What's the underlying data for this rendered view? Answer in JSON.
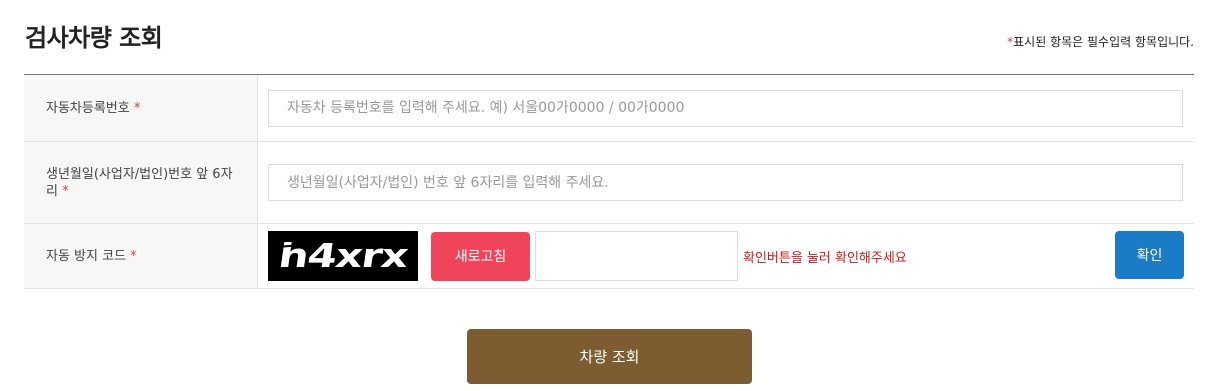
{
  "page": {
    "title": "검사차량 조회",
    "required_note_star": "*",
    "required_note_text": "표시된 항목은 필수입력 항목입니다."
  },
  "form": {
    "vehicle_number": {
      "label": "자동차등록번호",
      "required_mark": "*",
      "placeholder": "자동차 등록번호를 입력해 주세요. 예) 서울00가0000 / 00가0000",
      "value": ""
    },
    "birth_date": {
      "label": "생년월일(사업자/법인)번호 앞 6자리",
      "required_mark": "*",
      "placeholder": "생년월일(사업자/법인) 번호 앞 6자리를 입력해 주세요.",
      "value": ""
    },
    "captcha": {
      "label": "자동 방지 코드",
      "required_mark": "*",
      "image_text": "h4xrx",
      "refresh_label": "새로고침",
      "input_value": "",
      "message": "확인버튼을 눌러 확인해주세요",
      "confirm_label": "확인"
    }
  },
  "actions": {
    "search_label": "차량 조회"
  },
  "colors": {
    "required_star": "#e03a3a",
    "refresh_button": "#f0445a",
    "confirm_button": "#1a7cc6",
    "search_button": "#7c5c30",
    "error_text": "#d01a1a"
  }
}
